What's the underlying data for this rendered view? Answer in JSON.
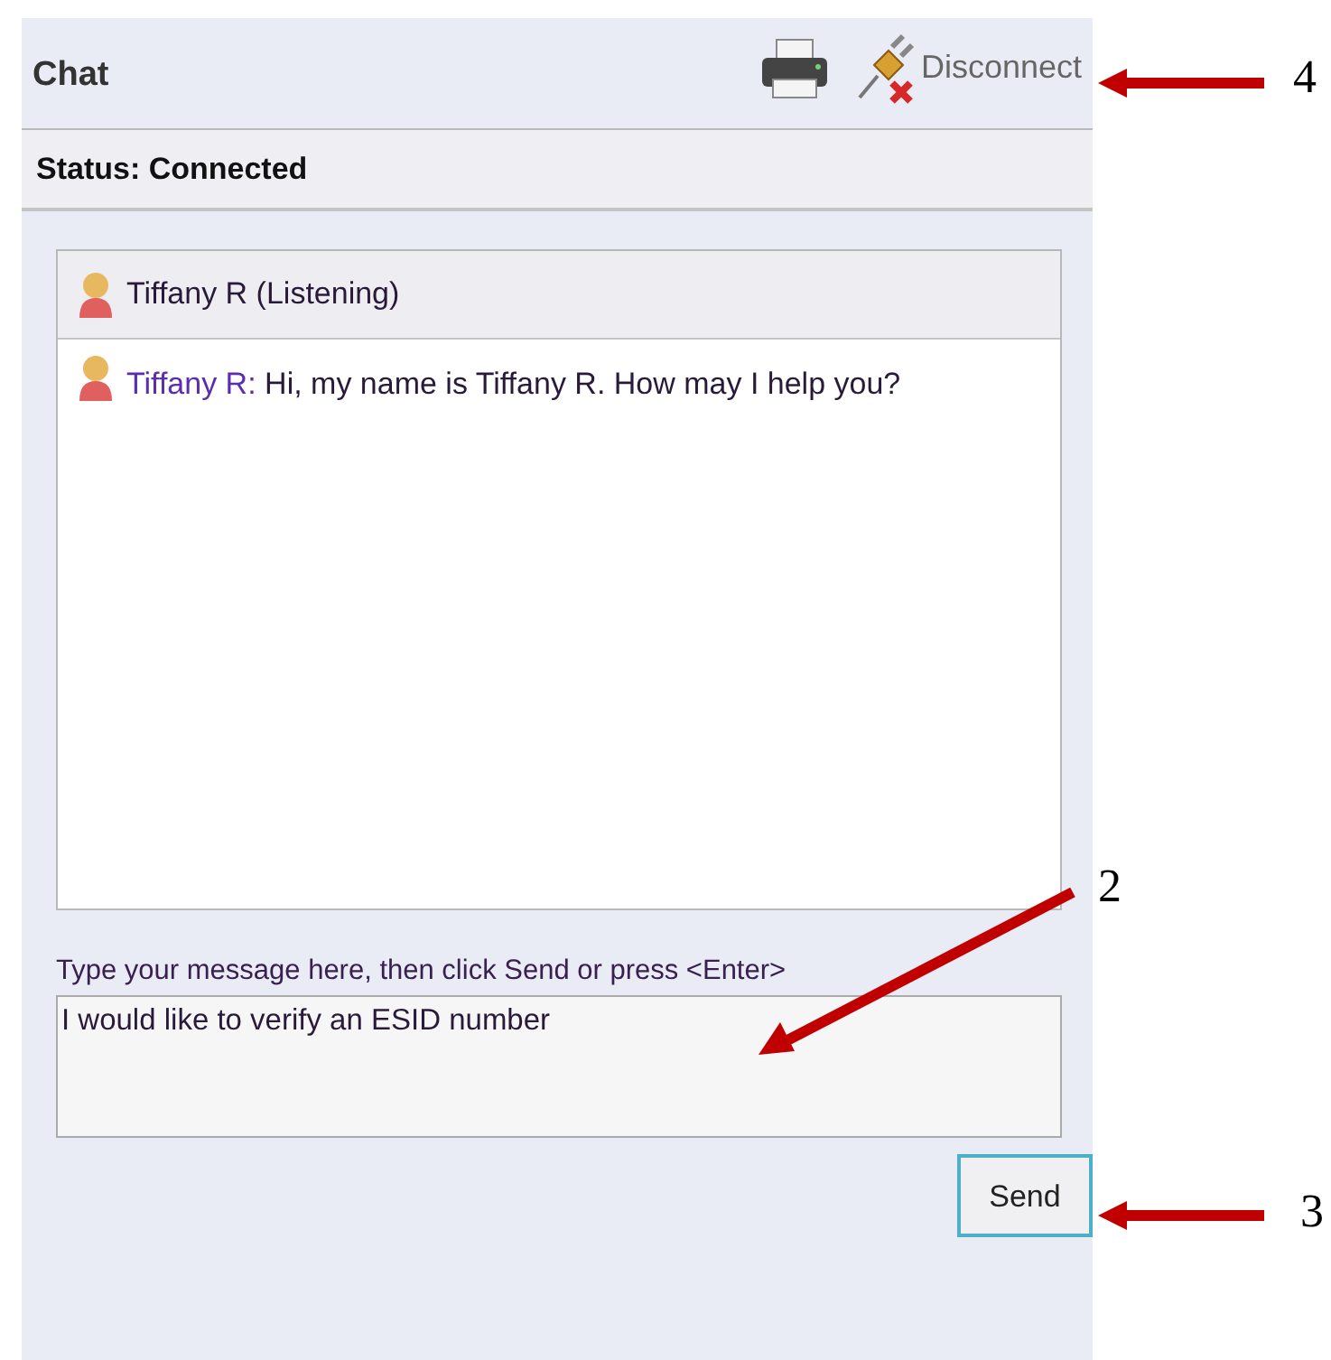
{
  "window": {
    "title": "Chat"
  },
  "toolbar": {
    "disconnect": "Disconnect"
  },
  "status": "Status: Connected",
  "chat": {
    "participant": "Tiffany R (Listening)",
    "messages": [
      {
        "sender": "Tiffany R:",
        "text": "Hi, my name is Tiffany R. How may I help you?"
      }
    ]
  },
  "compose": {
    "hint": "Type your message here, then click Send or press <Enter>",
    "value": "I would like to verify an ESID number",
    "button": "Send"
  },
  "annotations": [
    {
      "label": "4"
    },
    {
      "label": "2"
    },
    {
      "label": "3"
    }
  ]
}
